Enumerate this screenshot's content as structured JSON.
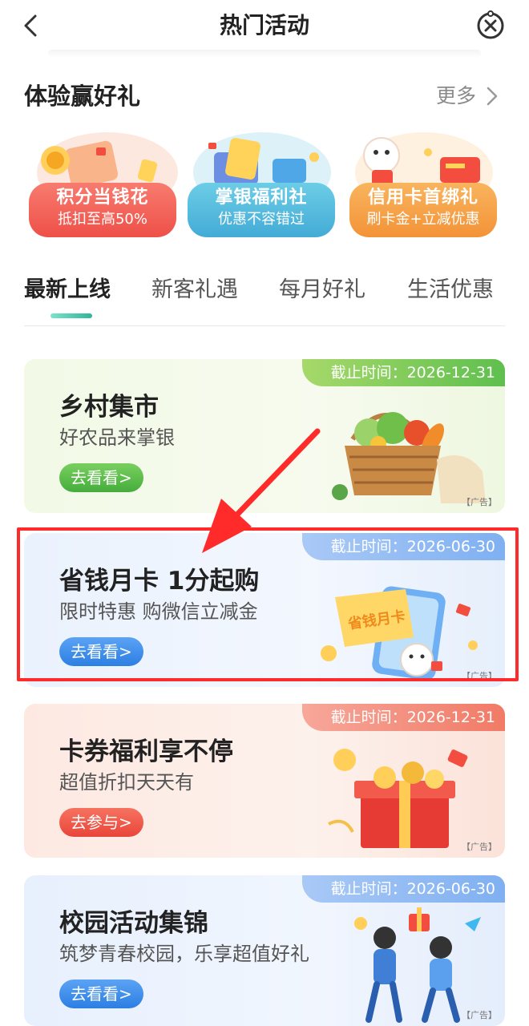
{
  "header": {
    "title": "热门活动"
  },
  "experience": {
    "title": "体验赢好礼",
    "more": "更多"
  },
  "promos": [
    {
      "title": "积分当钱花",
      "subtitle": "抵扣至高50%",
      "color": "#f0665f"
    },
    {
      "title": "掌银福利社",
      "subtitle": "优惠不容错过",
      "color": "#52b8dc"
    },
    {
      "title": "信用卡首绑礼",
      "subtitle": "刷卡金+立减优惠",
      "color": "#f4a24d"
    }
  ],
  "tabs": [
    "最新上线",
    "新客礼遇",
    "每月好礼",
    "生活优惠"
  ],
  "active_tab": "最新上线",
  "cards": [
    {
      "deadline": "截止时间：2026-12-31",
      "title": "乡村集市",
      "subtitle": "好农品来掌银",
      "button": "去看看>",
      "ad": "【广告】",
      "accent": "#5fbf4e"
    },
    {
      "deadline": "截止时间：2026-06-30",
      "title": "省钱月卡 1分起购",
      "subtitle": "限时特惠 购微信立减金",
      "button": "去看看>",
      "ad": "【广告】",
      "accent": "#3d8ff0",
      "tag_text": "省钱月卡"
    },
    {
      "deadline": "截止时间：2026-12-31",
      "title": "卡券福利享不停",
      "subtitle": "超值折扣天天有",
      "button": "去参与>",
      "ad": "【广告】",
      "accent": "#ef5a4a"
    },
    {
      "deadline": "截止时间：2026-06-30",
      "title": "校园活动集锦",
      "subtitle": "筑梦青春校园，乐享超值好礼",
      "button": "去看看>",
      "ad": "【广告】",
      "accent": "#3d8ff0"
    }
  ]
}
